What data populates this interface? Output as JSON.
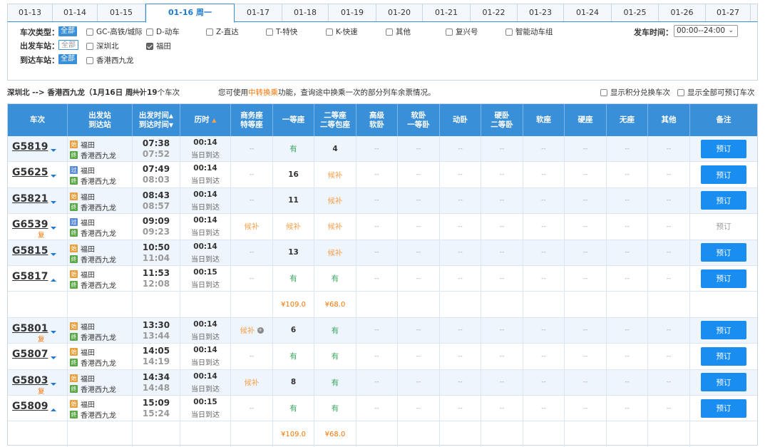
{
  "date_tabs": [
    "01-13",
    "01-14",
    "01-15",
    "01-16 周一",
    "01-17",
    "01-18",
    "01-19",
    "01-20",
    "01-21",
    "01-22",
    "01-23",
    "01-24",
    "01-25",
    "01-26",
    "01-27"
  ],
  "filters": {
    "type_label": "车次类型：",
    "all_label": "全部",
    "types": [
      "GC-高铁/城际",
      "D-动车",
      "Z-直达",
      "T-特快",
      "K-快速",
      "其他",
      "复兴号",
      "智能动车组"
    ],
    "depart_label": "出发车站：",
    "depart_stations": [
      "深圳北",
      "福田"
    ],
    "arrive_label": "到达车站：",
    "arrive_stations": [
      "香港西九龙"
    ],
    "time_label": "发车时间：",
    "time_value": "00:00--24:00"
  },
  "summary": {
    "route": "深圳北 --> 香港西九龙（1月16日  周一）",
    "count_prefix": "共计",
    "count": "19",
    "count_suffix": "个车次",
    "hint_before": "您可使用",
    "hint_link": "中转换乘",
    "hint_after": "功能，查询途中换乘一次的部分列车余票情况。",
    "opt_points": "显示积分兑换车次",
    "opt_bookable": "显示全部可预订车次"
  },
  "headers": {
    "train": "车次",
    "station_1": "出发站",
    "station_2": "到达站",
    "time_1": "出发时间",
    "time_2": "到达时间",
    "duration": "历时",
    "business_1": "商务座",
    "business_2": "特等座",
    "first": "一等座",
    "second_1": "二等座",
    "second_2": "二等包座",
    "soft_premium_1": "高级",
    "soft_premium_2": "软卧",
    "soft_sleeper_1": "软卧",
    "soft_sleeper_2": "一等卧",
    "dongwo": "动卧",
    "hard_sleeper_1": "硬卧",
    "hard_sleeper_2": "二等卧",
    "soft_seat": "软座",
    "hard_seat": "硬座",
    "no_seat": "无座",
    "other": "其他",
    "remark": "备注"
  },
  "tags": {
    "start": "始",
    "pass": "过",
    "end": "终"
  },
  "same_day": "当日到达",
  "dash": "--",
  "book_label": "预订",
  "fu_label": "复",
  "trains": [
    {
      "no": "G5819",
      "fu": "",
      "dir": "down",
      "tag1": "始",
      "from": "福田",
      "tag2": "终",
      "to": "香港西九龙",
      "dep": "07:38",
      "arr": "07:52",
      "dur": "00:14",
      "biz": "--",
      "first": "有",
      "second": "4",
      "book": "预订"
    },
    {
      "no": "G5625",
      "fu": "",
      "dir": "down",
      "tag1": "过",
      "from": "福田",
      "tag2": "终",
      "to": "香港西九龙",
      "dep": "07:49",
      "arr": "08:03",
      "dur": "00:14",
      "biz": "--",
      "first": "16",
      "second": "候补",
      "book": "预订"
    },
    {
      "no": "G5821",
      "fu": "",
      "dir": "down",
      "tag1": "始",
      "from": "福田",
      "tag2": "终",
      "to": "香港西九龙",
      "dep": "08:43",
      "arr": "08:57",
      "dur": "00:14",
      "biz": "--",
      "first": "11",
      "second": "候补",
      "book": "预订"
    },
    {
      "no": "G6539",
      "fu": "复",
      "dir": "down",
      "tag1": "过",
      "from": "福田",
      "tag2": "终",
      "to": "香港西九龙",
      "dep": "09:09",
      "arr": "09:23",
      "dur": "00:14",
      "biz": "候补",
      "first": "候补",
      "second": "候补",
      "book": "预订"
    },
    {
      "no": "G5815",
      "fu": "",
      "dir": "down",
      "tag1": "始",
      "from": "福田",
      "tag2": "终",
      "to": "香港西九龙",
      "dep": "10:50",
      "arr": "11:04",
      "dur": "00:14",
      "biz": "--",
      "first": "13",
      "second": "候补",
      "book": "预订"
    },
    {
      "no": "G5817",
      "fu": "",
      "dir": "up",
      "tag1": "始",
      "from": "福田",
      "tag2": "终",
      "to": "香港西九龙",
      "dep": "11:53",
      "arr": "12:08",
      "dur": "00:15",
      "biz": "--",
      "first": "有",
      "second": "有",
      "book": "预订"
    },
    {
      "price_first": "¥109.0",
      "price_second": "¥68.0"
    },
    {
      "no": "G5801",
      "fu": "复",
      "dir": "down",
      "tag1": "始",
      "from": "福田",
      "tag2": "终",
      "to": "香港西九龙",
      "dep": "13:30",
      "arr": "13:44",
      "dur": "00:14",
      "biz": "候补",
      "first": "6",
      "second": "有",
      "book": "预订"
    },
    {
      "no": "G5807",
      "fu": "",
      "dir": "down",
      "tag1": "始",
      "from": "福田",
      "tag2": "终",
      "to": "香港西九龙",
      "dep": "14:05",
      "arr": "14:19",
      "dur": "00:14",
      "biz": "--",
      "first": "有",
      "second": "有",
      "book": "预订"
    },
    {
      "no": "G5803",
      "fu": "复",
      "dir": "down",
      "tag1": "始",
      "from": "福田",
      "tag2": "终",
      "to": "香港西九龙",
      "dep": "14:34",
      "arr": "14:48",
      "dur": "00:14",
      "biz": "候补",
      "first": "8",
      "second": "有",
      "book": "预订"
    },
    {
      "no": "G5809",
      "fu": "",
      "dir": "up",
      "tag1": "始",
      "from": "福田",
      "tag2": "终",
      "to": "香港西九龙",
      "dep": "15:09",
      "arr": "15:24",
      "dur": "00:15",
      "biz": "--",
      "first": "有",
      "second": "有",
      "book": "预订"
    },
    {
      "price_first": "¥109.0",
      "price_second": "¥68.0"
    }
  ],
  "colors": {
    "header_blue": "#3a8fd9",
    "book_blue": "#1a8df0",
    "available_green": "#3aa55f",
    "waitlist_orange": "#f5a14d",
    "price_orange": "#fb7403"
  }
}
